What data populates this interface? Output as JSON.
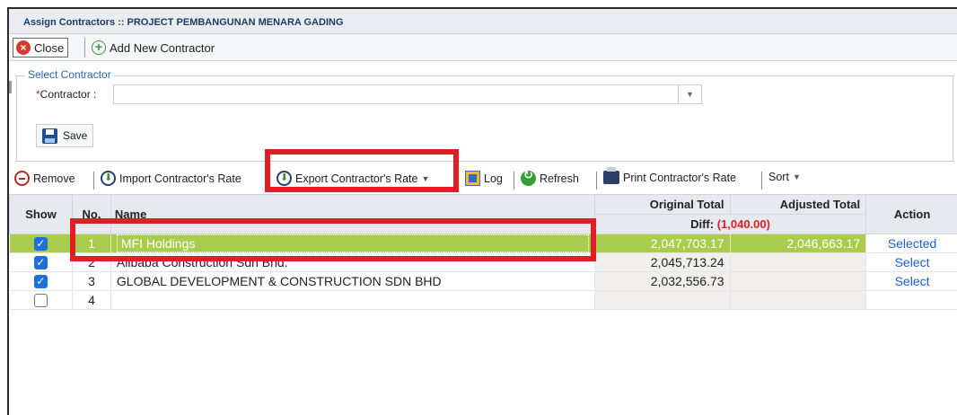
{
  "window": {
    "title": "Assign Contractors :: PROJECT PEMBANGUNAN MENARA GADING"
  },
  "topbar": {
    "close_label": "Close",
    "add_label": "Add New Contractor"
  },
  "select_contractor": {
    "legend": "Select Contractor",
    "required_mark": "*",
    "contractor_label": "Contractor :",
    "contractor_value": "",
    "save_label": "Save"
  },
  "toolbar": {
    "remove": "Remove",
    "import": "Import Contractor's Rate",
    "export": "Export Contractor's Rate",
    "log": "Log",
    "refresh": "Refresh",
    "print": "Print Contractor's Rate",
    "sort": "Sort"
  },
  "grid": {
    "headers": {
      "show": "Show",
      "no": "No.",
      "name": "Name",
      "original_total": "Original Total",
      "adjusted_total": "Adjusted Total",
      "diff_label": "Diff:",
      "diff_value": "(1,040.00)",
      "action": "Action"
    },
    "rows": [
      {
        "show": true,
        "no": "1",
        "name": "MFI Holdings",
        "original_total": "2,047,703.17",
        "adjusted_total": "2,046,663.17",
        "action": "Selected"
      },
      {
        "show": true,
        "no": "2",
        "name": "Alibaba Construction Sdn Bhd.",
        "original_total": "2,045,713.24",
        "adjusted_total": "",
        "action": "Select"
      },
      {
        "show": true,
        "no": "3",
        "name": "GLOBAL DEVELOPMENT & CONSTRUCTION SDN BHD",
        "original_total": "2,032,556.73",
        "adjusted_total": "",
        "action": "Select"
      },
      {
        "show": false,
        "no": "4",
        "name": "",
        "original_total": "",
        "adjusted_total": "",
        "action": ""
      }
    ]
  },
  "colors": {
    "highlight_red": "#e21d26",
    "selected_row": "#a9cc4c",
    "link_blue": "#1a5fd8"
  }
}
